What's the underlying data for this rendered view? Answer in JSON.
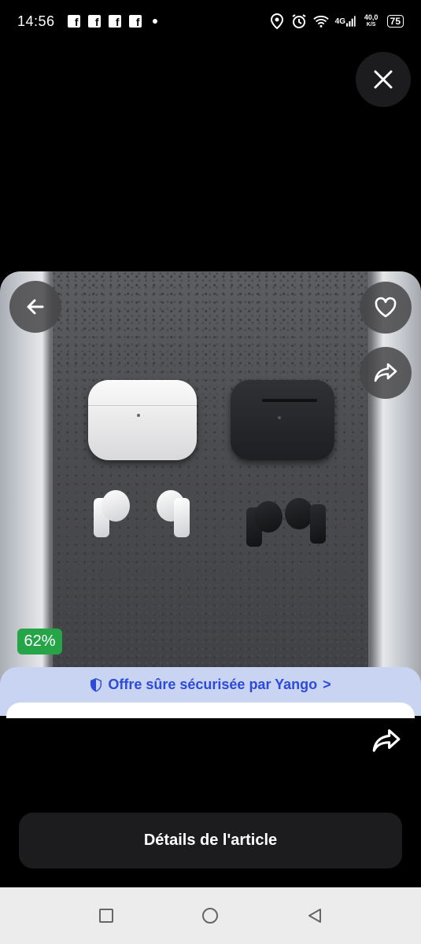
{
  "status_bar": {
    "time": "14:56",
    "notifications": [
      "facebook-icon",
      "facebook-icon",
      "facebook-icon",
      "facebook-icon"
    ],
    "network": "4G",
    "speed_value": "40,0",
    "speed_unit": "K/S",
    "battery": "75"
  },
  "product": {
    "discount_badge": "62%"
  },
  "safety_banner": {
    "text": "Offre sûre sécurisée par Yango",
    "chevron": ">"
  },
  "actions": {
    "details_button": "Détails de l'article"
  },
  "icons": {
    "close": "close-icon",
    "back": "arrow-left-icon",
    "favorite": "heart-icon",
    "share": "share-icon",
    "shield": "shield-icon"
  },
  "colors": {
    "discount_green": "#25a448",
    "yango_blue": "#2d4bd6",
    "banner_bg": "#c9d3f2"
  }
}
